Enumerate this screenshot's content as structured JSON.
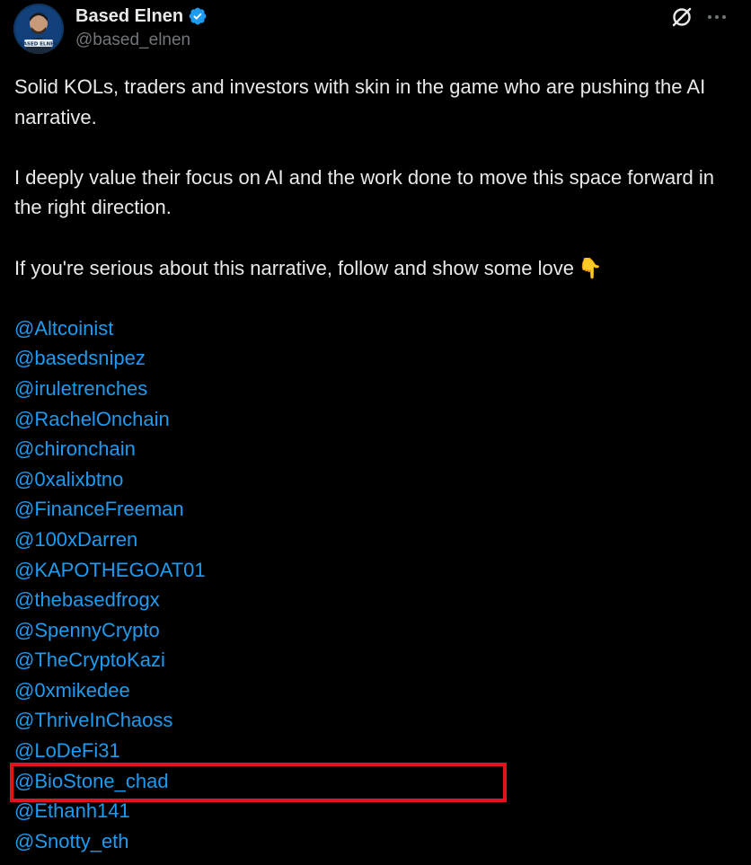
{
  "post": {
    "author": {
      "display_name": "Based Elnen",
      "handle": "@based_elnen",
      "avatar_text": "BASED ELNEN",
      "verified": true
    },
    "actions": {
      "grok_icon": "grok-slash-circle-icon",
      "more_icon": "more-dots-icon",
      "more_label": "···"
    },
    "body": {
      "paragraph_1": "Solid KOLs, traders and investors with skin in the game who are pushing the AI narrative.",
      "paragraph_2": "I deeply value their focus on AI and the work done to move this space forward in the right direction.",
      "paragraph_3": "If you're serious about this narrative, follow and show some love",
      "paragraph_3_emoji": "👇"
    },
    "mentions": [
      "@Altcoinist",
      "@basedsnipez",
      "@iruletrenches",
      "@RachelOnchain",
      "@chironchain",
      "@0xalixbtno",
      "@FinanceFreeman",
      "@100xDarren",
      "@KAPOTHEGOAT01",
      "@thebasedfrogx",
      "@SpennyCrypto",
      "@TheCryptoKazi",
      "@0xmikedee",
      "@ThriveInChaoss",
      "@LoDeFi31",
      "@BioStone_chad",
      "@Ethanh141",
      "@Snotty_eth"
    ],
    "highlighted_mention": "@BioStone_chad"
  },
  "colors": {
    "background": "#000000",
    "text": "#e7e9ea",
    "secondary_text": "#71767b",
    "link": "#1d9bf0",
    "verified_badge": "#1d9bf0",
    "highlight_border": "#e0141c"
  }
}
